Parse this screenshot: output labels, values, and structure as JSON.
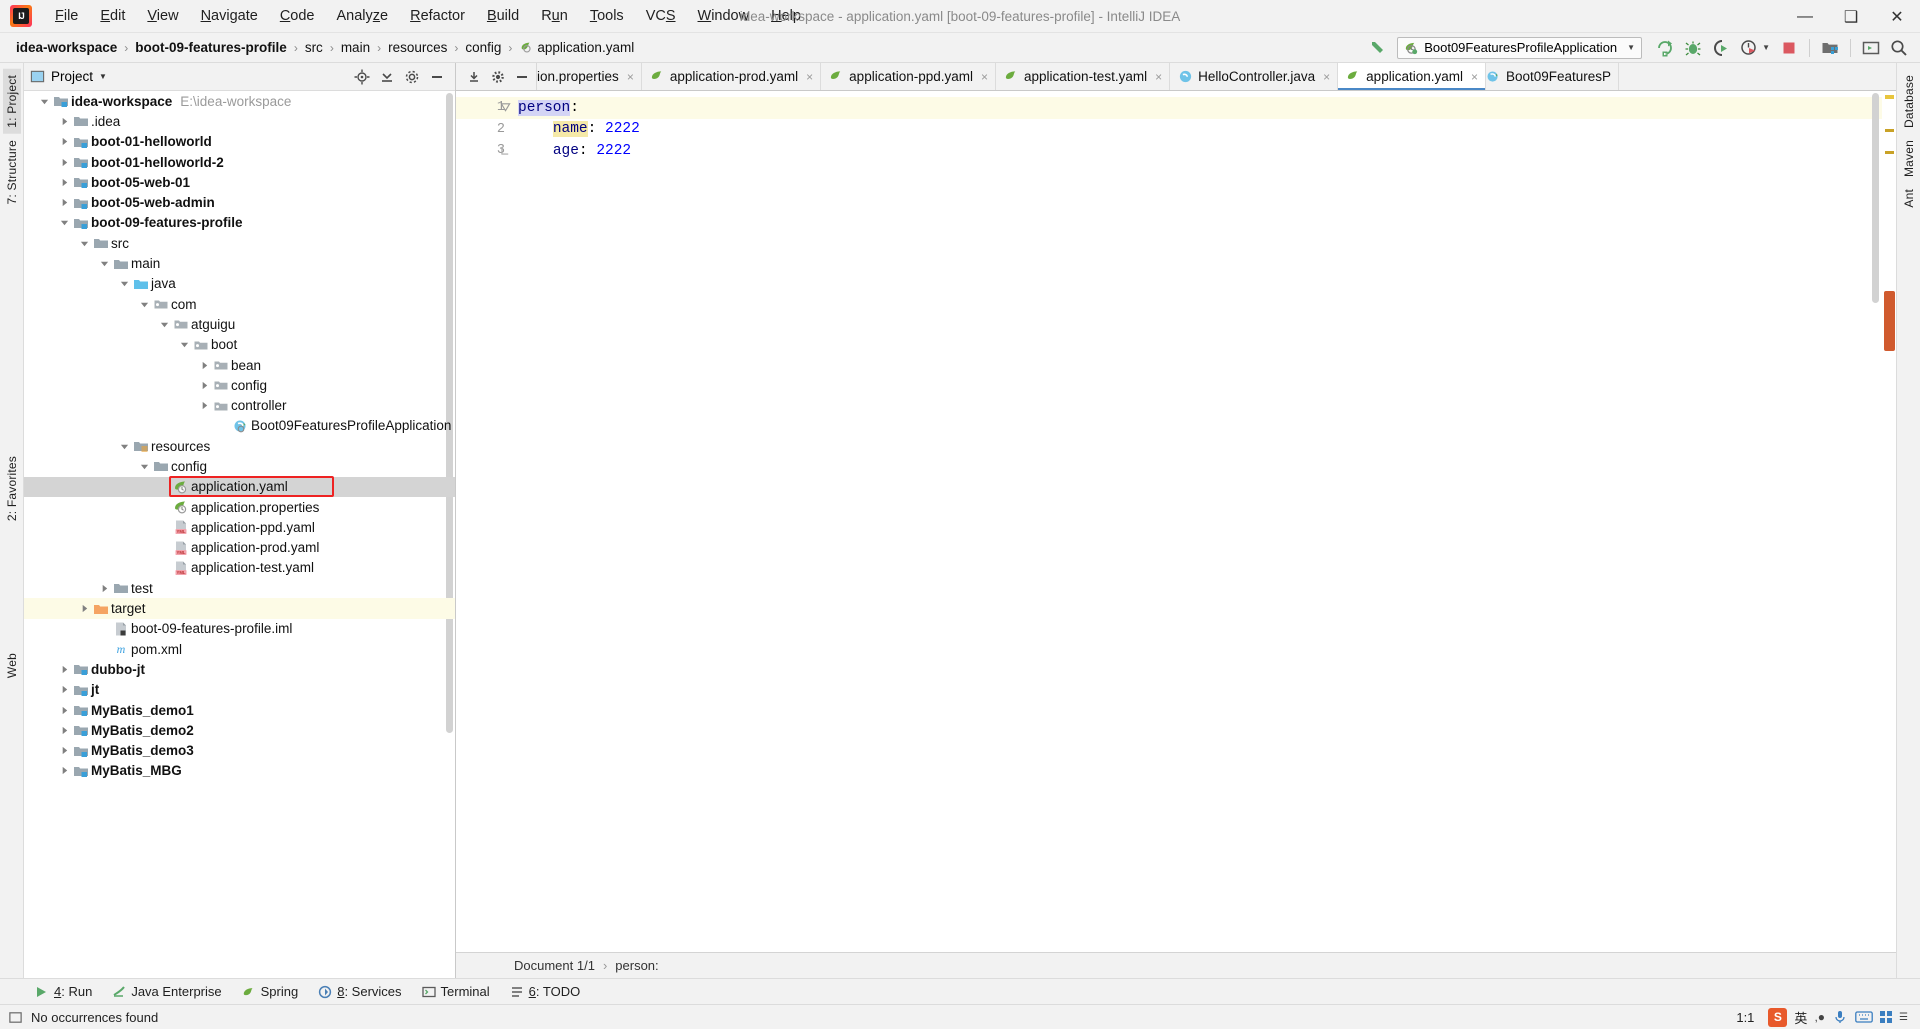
{
  "titlebar": {
    "window_title": "idea-workspace - application.yaml [boot-09-features-profile] - IntelliJ IDEA",
    "menus": [
      "File",
      "Edit",
      "View",
      "Navigate",
      "Code",
      "Analyze",
      "Refactor",
      "Build",
      "Run",
      "Tools",
      "VCS",
      "Window",
      "Help"
    ],
    "controls": {
      "minimize": "—",
      "maximize": "❑",
      "close": "✕"
    }
  },
  "breadcrumb": {
    "segments": [
      "idea-workspace",
      "boot-09-features-profile",
      "src",
      "main",
      "resources",
      "config",
      "application.yaml"
    ],
    "separator": "›"
  },
  "toolbar": {
    "run_config": "Boot09FeaturesProfileApplication",
    "icons": [
      "back-arrow-icon",
      "run-icon",
      "debug-icon",
      "run-coverage-icon",
      "profiler-icon",
      "stop-icon",
      "project-structure-icon",
      "terminal-icon",
      "search-everywhere-icon"
    ]
  },
  "left_strip": {
    "tabs": [
      "1: Project",
      "7: Structure",
      "2: Favorites",
      "Web"
    ]
  },
  "right_strip": {
    "tabs": [
      "Database",
      "Maven",
      "Ant"
    ]
  },
  "project_panel": {
    "title": "Project",
    "header_icons": [
      "locate-icon",
      "collapse-all-icon",
      "settings-icon",
      "hide-icon"
    ],
    "tree": [
      {
        "depth": 0,
        "arrow": "down",
        "icon": "module-root",
        "label": "idea-workspace",
        "bold": true,
        "sub": "E:\\idea-workspace"
      },
      {
        "depth": 1,
        "arrow": "right",
        "icon": "folder",
        "label": ".idea",
        "bold": false,
        "sub": ""
      },
      {
        "depth": 1,
        "arrow": "right",
        "icon": "module",
        "label": "boot-01-helloworld",
        "bold": true,
        "sub": ""
      },
      {
        "depth": 1,
        "arrow": "right",
        "icon": "module",
        "label": "boot-01-helloworld-2",
        "bold": true,
        "sub": ""
      },
      {
        "depth": 1,
        "arrow": "right",
        "icon": "module",
        "label": "boot-05-web-01",
        "bold": true,
        "sub": ""
      },
      {
        "depth": 1,
        "arrow": "right",
        "icon": "module",
        "label": "boot-05-web-admin",
        "bold": true,
        "sub": ""
      },
      {
        "depth": 1,
        "arrow": "down",
        "icon": "module",
        "label": "boot-09-features-profile",
        "bold": true,
        "sub": ""
      },
      {
        "depth": 2,
        "arrow": "down",
        "icon": "folder",
        "label": "src",
        "bold": false,
        "sub": ""
      },
      {
        "depth": 3,
        "arrow": "down",
        "icon": "folder",
        "label": "main",
        "bold": false,
        "sub": ""
      },
      {
        "depth": 4,
        "arrow": "down",
        "icon": "source-root",
        "label": "java",
        "bold": false,
        "sub": ""
      },
      {
        "depth": 5,
        "arrow": "down",
        "icon": "package",
        "label": "com",
        "bold": false,
        "sub": ""
      },
      {
        "depth": 6,
        "arrow": "down",
        "icon": "package",
        "label": "atguigu",
        "bold": false,
        "sub": ""
      },
      {
        "depth": 7,
        "arrow": "down",
        "icon": "package",
        "label": "boot",
        "bold": false,
        "sub": ""
      },
      {
        "depth": 8,
        "arrow": "right",
        "icon": "package",
        "label": "bean",
        "bold": false,
        "sub": ""
      },
      {
        "depth": 8,
        "arrow": "right",
        "icon": "package",
        "label": "config",
        "bold": false,
        "sub": ""
      },
      {
        "depth": 8,
        "arrow": "right",
        "icon": "package",
        "label": "controller",
        "bold": false,
        "sub": ""
      },
      {
        "depth": 9,
        "arrow": "none",
        "icon": "spring-class",
        "label": "Boot09FeaturesProfileApplication",
        "bold": false,
        "sub": ""
      },
      {
        "depth": 4,
        "arrow": "down",
        "icon": "resource-root",
        "label": "resources",
        "bold": false,
        "sub": ""
      },
      {
        "depth": 5,
        "arrow": "down",
        "icon": "folder",
        "label": "config",
        "bold": false,
        "sub": ""
      },
      {
        "depth": 6,
        "arrow": "none",
        "icon": "spring-yaml",
        "label": "application.yaml",
        "bold": false,
        "sub": "",
        "selected": true,
        "annotated": true
      },
      {
        "depth": 6,
        "arrow": "none",
        "icon": "spring-yaml",
        "label": "application.properties",
        "bold": false,
        "sub": ""
      },
      {
        "depth": 6,
        "arrow": "none",
        "icon": "yml-file",
        "label": "application-ppd.yaml",
        "bold": false,
        "sub": ""
      },
      {
        "depth": 6,
        "arrow": "none",
        "icon": "yml-file",
        "label": "application-prod.yaml",
        "bold": false,
        "sub": ""
      },
      {
        "depth": 6,
        "arrow": "none",
        "icon": "yml-file",
        "label": "application-test.yaml",
        "bold": false,
        "sub": ""
      },
      {
        "depth": 3,
        "arrow": "right",
        "icon": "folder",
        "label": "test",
        "bold": false,
        "sub": ""
      },
      {
        "depth": 2,
        "arrow": "right",
        "icon": "excluded-folder",
        "label": "target",
        "bold": false,
        "sub": "",
        "highlight": true
      },
      {
        "depth": 3,
        "arrow": "none",
        "icon": "iml-file",
        "label": "boot-09-features-profile.iml",
        "bold": false,
        "sub": ""
      },
      {
        "depth": 3,
        "arrow": "none",
        "icon": "maven-file",
        "label": "pom.xml",
        "bold": false,
        "sub": ""
      },
      {
        "depth": 1,
        "arrow": "right",
        "icon": "module",
        "label": "dubbo-jt",
        "bold": true,
        "sub": ""
      },
      {
        "depth": 1,
        "arrow": "right",
        "icon": "module",
        "label": "jt",
        "bold": true,
        "sub": ""
      },
      {
        "depth": 1,
        "arrow": "right",
        "icon": "module",
        "label": "MyBatis_demo1",
        "bold": true,
        "sub": ""
      },
      {
        "depth": 1,
        "arrow": "right",
        "icon": "module",
        "label": "MyBatis_demo2",
        "bold": true,
        "sub": ""
      },
      {
        "depth": 1,
        "arrow": "right",
        "icon": "module",
        "label": "MyBatis_demo3",
        "bold": true,
        "sub": ""
      },
      {
        "depth": 1,
        "arrow": "right",
        "icon": "module",
        "label": "MyBatis_MBG",
        "bold": true,
        "sub": ""
      }
    ]
  },
  "editor": {
    "tabs": [
      {
        "label": "ion.properties",
        "icon": "spring-yaml",
        "active": false,
        "clipped": true
      },
      {
        "label": "application-prod.yaml",
        "icon": "yaml-leaf",
        "active": false
      },
      {
        "label": "application-ppd.yaml",
        "icon": "yaml-leaf",
        "active": false
      },
      {
        "label": "application-test.yaml",
        "icon": "yaml-leaf",
        "active": false
      },
      {
        "label": "HelloController.java",
        "icon": "java-class",
        "active": false
      },
      {
        "label": "application.yaml",
        "icon": "yaml-leaf",
        "active": true
      },
      {
        "label": "Boot09FeaturesP",
        "icon": "spring-class",
        "active": false,
        "clipped": true
      }
    ],
    "close_glyph": "×",
    "lines": [
      {
        "num": "1",
        "indent": 0,
        "key": "person",
        "colon": ":",
        "value": "",
        "fold": "down",
        "current": true
      },
      {
        "num": "2",
        "indent": 2,
        "key": "name",
        "colon": ":",
        "value": "2222",
        "fold": "none",
        "current": false
      },
      {
        "num": "3",
        "indent": 2,
        "key": "age",
        "colon": ":",
        "value": "2222",
        "fold": "lock",
        "current": false
      }
    ]
  },
  "doc_bar": {
    "document": "Document 1/1",
    "separator": "›",
    "path": "person:"
  },
  "bottom_tools": [
    {
      "label": "4: Run",
      "icon": "run-icon",
      "accel": "4"
    },
    {
      "label": "Java Enterprise",
      "icon": "java-ee-icon",
      "accel": ""
    },
    {
      "label": "Spring",
      "icon": "spring-icon",
      "accel": ""
    },
    {
      "label": "8: Services",
      "icon": "services-icon",
      "accel": "8"
    },
    {
      "label": "Terminal",
      "icon": "terminal-icon",
      "accel": ""
    },
    {
      "label": "6: TODO",
      "icon": "todo-icon",
      "accel": "6"
    }
  ],
  "status": {
    "message": "No occurrences found",
    "caret_position": "1:1",
    "ime_lang": "英",
    "ime_badge": "S"
  },
  "colors": {
    "accent_blue": "#4a88c7",
    "selection_gray": "#d4d4d4",
    "annotation_red": "#ee2222",
    "caret_line": "#fdfbe6",
    "keyword_navy": "#000080",
    "number_blue": "#0000ff",
    "spring_green": "#6cac3f"
  }
}
